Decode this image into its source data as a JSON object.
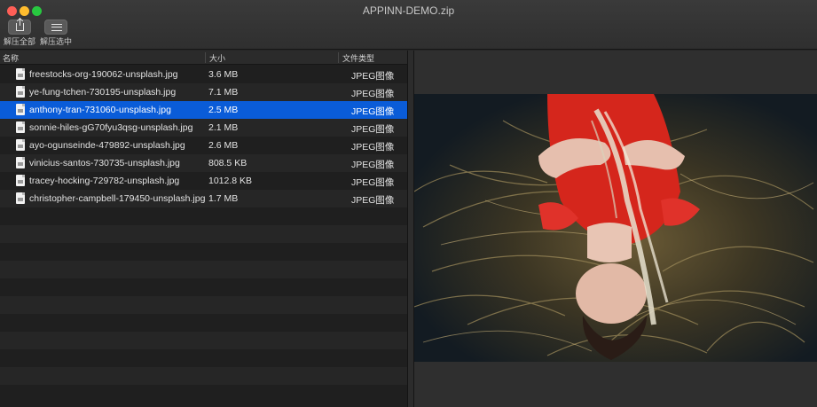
{
  "window": {
    "title": "APPINN-DEMO.zip"
  },
  "toolbar": {
    "extract_all_label": "解压全部",
    "extract_selected_label": "解压选中"
  },
  "columns": {
    "name": "名称",
    "size": "大小",
    "type": "文件类型"
  },
  "files": [
    {
      "name": "freestocks-org-190062-unsplash.jpg",
      "size": "3.6 MB",
      "type": "JPEG图像",
      "selected": false
    },
    {
      "name": "ye-fung-tchen-730195-unsplash.jpg",
      "size": "7.1 MB",
      "type": "JPEG图像",
      "selected": false
    },
    {
      "name": "anthony-tran-731060-unsplash.jpg",
      "size": "2.5 MB",
      "type": "JPEG图像",
      "selected": true
    },
    {
      "name": "sonnie-hiles-gG70fyu3qsg-unsplash.jpg",
      "size": "2.1 MB",
      "type": "JPEG图像",
      "selected": false
    },
    {
      "name": "ayo-ogunseinde-479892-unsplash.jpg",
      "size": "2.6 MB",
      "type": "JPEG图像",
      "selected": false
    },
    {
      "name": "vinicius-santos-730735-unsplash.jpg",
      "size": "808.5 KB",
      "type": "JPEG图像",
      "selected": false
    },
    {
      "name": "tracey-hocking-729782-unsplash.jpg",
      "size": "1012.8 KB",
      "type": "JPEG图像",
      "selected": false
    },
    {
      "name": "christopher-campbell-179450-unsplash.jpg",
      "size": "1.7 MB",
      "type": "JPEG图像",
      "selected": false
    }
  ],
  "colors": {
    "selection": "#0a5cd8",
    "dress_red": "#d5261c",
    "traffic_close": "#fe5f57",
    "traffic_minimize": "#febc2e",
    "traffic_zoom": "#28c840"
  },
  "icons": {
    "extract_all": "share-icon",
    "extract_selected": "list-icon",
    "file": "jpeg-file-icon"
  }
}
